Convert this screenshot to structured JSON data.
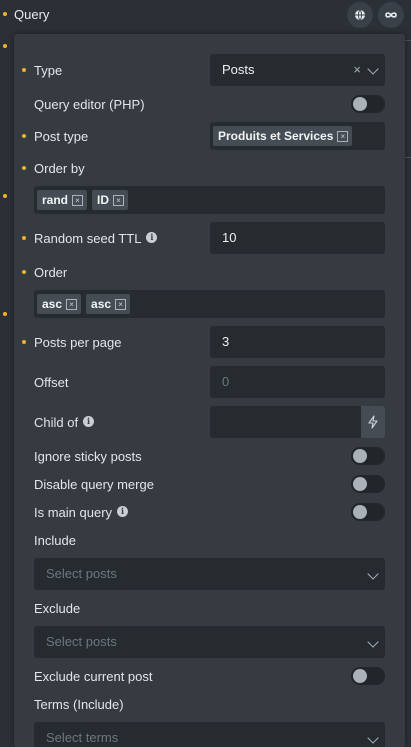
{
  "header": {
    "title": "Query",
    "globe_icon": "globe-icon",
    "loop_icon": "infinity-icon"
  },
  "fields": {
    "type": {
      "label": "Type",
      "value": "Posts",
      "clear": "×"
    },
    "query_editor": {
      "label": "Query editor (PHP)"
    },
    "post_type": {
      "label": "Post type",
      "tags": [
        "Produits et Services"
      ]
    },
    "order_by": {
      "label": "Order by",
      "tags": [
        "rand",
        "ID"
      ]
    },
    "random_seed_ttl": {
      "label": "Random seed TTL",
      "value": "10"
    },
    "order": {
      "label": "Order",
      "tags": [
        "asc",
        "asc"
      ]
    },
    "posts_per_page": {
      "label": "Posts per page",
      "value": "3"
    },
    "offset": {
      "label": "Offset",
      "placeholder": "0"
    },
    "child_of": {
      "label": "Child of"
    },
    "ignore_sticky": {
      "label": "Ignore sticky posts"
    },
    "disable_query_merge": {
      "label": "Disable query merge"
    },
    "is_main_query": {
      "label": "Is main query"
    },
    "include": {
      "label": "Include",
      "placeholder": "Select posts"
    },
    "exclude": {
      "label": "Exclude",
      "placeholder": "Select posts"
    },
    "exclude_current": {
      "label": "Exclude current post"
    },
    "terms_include": {
      "label": "Terms (Include)",
      "placeholder": "Select terms"
    }
  },
  "tag_remove_glyph": "×",
  "info_glyph": "i",
  "colors": {
    "accent_dot": "#f0b429",
    "panel": "#353b41",
    "field": "#262b30"
  }
}
